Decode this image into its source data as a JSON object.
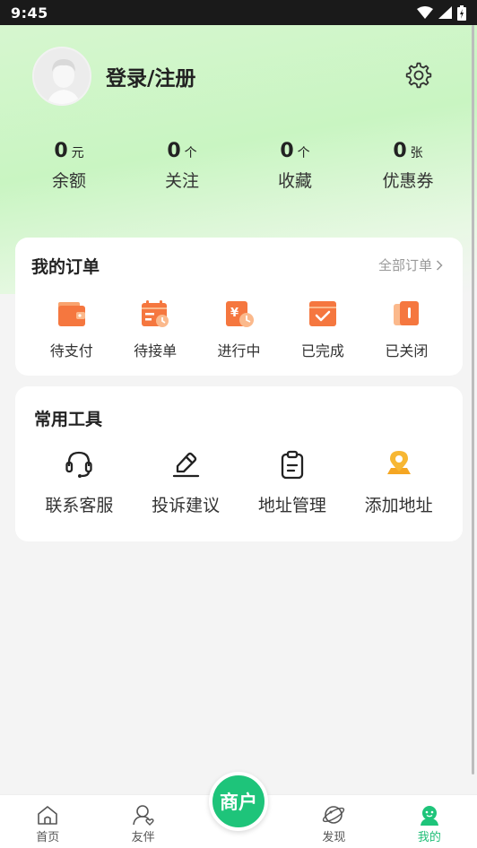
{
  "status_bar": {
    "time": "9:45"
  },
  "profile": {
    "login_label": "登录/注册"
  },
  "stats": [
    {
      "value": "0",
      "unit": "元",
      "label": "余额"
    },
    {
      "value": "0",
      "unit": "个",
      "label": "关注"
    },
    {
      "value": "0",
      "unit": "个",
      "label": "收藏"
    },
    {
      "value": "0",
      "unit": "张",
      "label": "优惠券"
    }
  ],
  "orders": {
    "title": "我的订单",
    "all_link": "全部订单",
    "items": [
      {
        "label": "待支付",
        "icon": "wallet-icon"
      },
      {
        "label": "待接单",
        "icon": "calendar-pending-icon"
      },
      {
        "label": "进行中",
        "icon": "in-progress-icon"
      },
      {
        "label": "已完成",
        "icon": "completed-icon"
      },
      {
        "label": "已关闭",
        "icon": "closed-icon"
      }
    ]
  },
  "tools": {
    "title": "常用工具",
    "items": [
      {
        "label": "联系客服",
        "icon": "headset-icon"
      },
      {
        "label": "投诉建议",
        "icon": "edit-icon"
      },
      {
        "label": "地址管理",
        "icon": "clipboard-icon"
      },
      {
        "label": "添加地址",
        "icon": "location-pin-icon"
      }
    ]
  },
  "tabbar": {
    "items": [
      {
        "label": "首页",
        "icon": "home-icon"
      },
      {
        "label": "友伴",
        "icon": "friend-icon"
      },
      {
        "label": "发现",
        "icon": "planet-icon"
      },
      {
        "label": "我的",
        "icon": "profile-icon"
      }
    ],
    "center_label": "商户"
  },
  "colors": {
    "accent": "#1ec47a",
    "order_icon": "#f5773f",
    "tool_pin": "#f5a623"
  }
}
